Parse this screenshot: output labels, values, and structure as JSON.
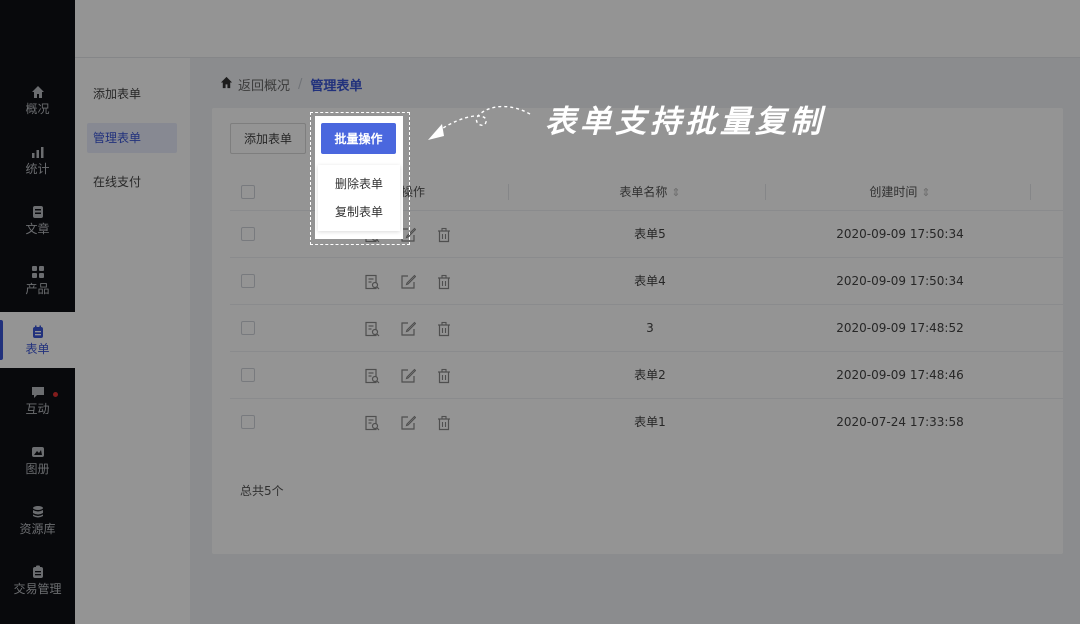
{
  "sidebar": {
    "items": [
      {
        "label": "概况",
        "icon": "home-icon"
      },
      {
        "label": "统计",
        "icon": "stats-icon"
      },
      {
        "label": "文章",
        "icon": "article-icon"
      },
      {
        "label": "产品",
        "icon": "apps-icon"
      },
      {
        "label": "表单",
        "icon": "form-icon",
        "active": true
      },
      {
        "label": "互动",
        "icon": "chat-icon",
        "badge": true
      },
      {
        "label": "图册",
        "icon": "album-icon"
      },
      {
        "label": "资源库",
        "icon": "database-icon"
      },
      {
        "label": "交易管理",
        "icon": "order-icon"
      }
    ]
  },
  "submenu": {
    "items": [
      {
        "label": "添加表单"
      },
      {
        "label": "管理表单",
        "active": true
      },
      {
        "label": "在线支付"
      }
    ]
  },
  "breadcrumb": {
    "back": "返回概况",
    "separator": "/",
    "current": "管理表单"
  },
  "toolbar": {
    "add_label": "添加表单",
    "batch_label": "批量操作"
  },
  "batch_menu": {
    "items": [
      "删除表单",
      "复制表单"
    ]
  },
  "table": {
    "headers": {
      "actions": "操作",
      "name": "表单名称",
      "created": "创建时间"
    },
    "rows": [
      {
        "name": "表单5",
        "created": "2020-09-09 17:50:34"
      },
      {
        "name": "表单4",
        "created": "2020-09-09 17:50:34"
      },
      {
        "name": "3",
        "created": "2020-09-09 17:48:52"
      },
      {
        "name": "表单2",
        "created": "2020-09-09 17:48:46"
      },
      {
        "name": "表单1",
        "created": "2020-07-24 17:33:58"
      }
    ],
    "total": "总共5个"
  },
  "annotation": {
    "text": "表单支持批量复制"
  },
  "colors": {
    "accent": "#4a67de",
    "sidebar_bg": "#0e1015",
    "badge": "#e03131"
  }
}
